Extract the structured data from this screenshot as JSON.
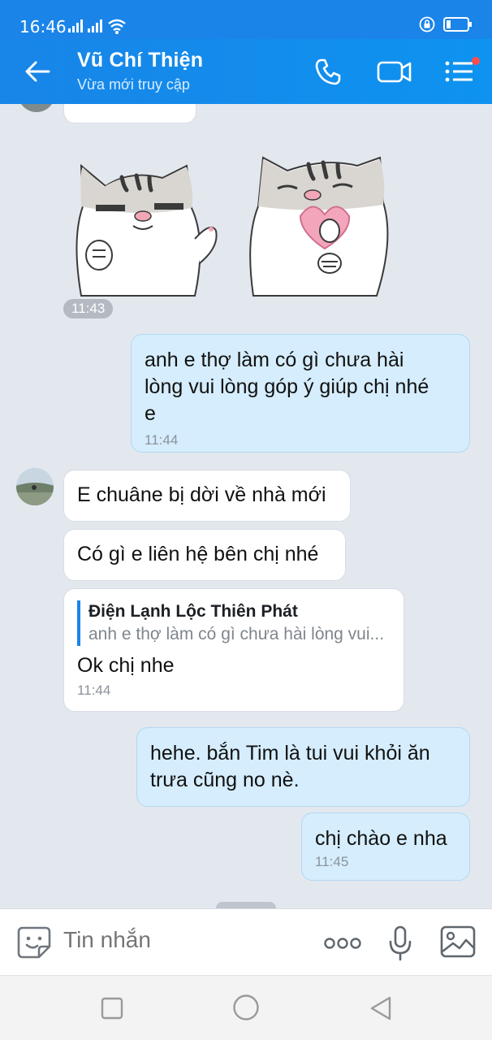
{
  "status_bar": {
    "time": "16:46",
    "battery": "battery-low",
    "lock": "lock-icon"
  },
  "header": {
    "name": "Vũ Chí Thiện",
    "status": "Vừa mới truy cập",
    "accent": "#1a84e8"
  },
  "messages": [
    {
      "type": "sticker",
      "direction": "in",
      "time": "11:43"
    },
    {
      "type": "text",
      "direction": "out",
      "text_lines": [
        "anh e thợ làm có gì chưa hài",
        "lòng vui lòng góp ý giúp chị nhé",
        "e"
      ],
      "time": "11:44"
    },
    {
      "type": "text",
      "direction": "in",
      "text": "E chuâne bị dời về nhà mới"
    },
    {
      "type": "text",
      "direction": "in",
      "text": "Có gì e liên hệ bên chị nhé"
    },
    {
      "type": "reply",
      "direction": "in",
      "quote_name": "Điện Lạnh Lộc Thiên Phát",
      "quote_text": "anh e thợ làm có gì chưa hài lòng vui...",
      "text": "Ok chị nhe",
      "time": "11:44"
    },
    {
      "type": "text",
      "direction": "out",
      "text_lines": [
        "hehe. bắn Tim là tui vui khỏi ăn",
        "trưa cũng no nè."
      ]
    },
    {
      "type": "text",
      "direction": "out",
      "text": "chị chào e nha",
      "time": "11:45"
    }
  ],
  "input": {
    "placeholder": "Tin nhắn"
  },
  "icons": {
    "back": "back-arrow-icon",
    "call": "phone-icon",
    "video": "video-camera-icon",
    "menu": "menu-icon",
    "sticker": "sticker-emoji-icon",
    "more": "more-icon",
    "mic": "microphone-icon",
    "image": "image-icon",
    "nav_recent": "square-icon",
    "nav_home": "circle-icon",
    "nav_back": "triangle-back-icon"
  }
}
